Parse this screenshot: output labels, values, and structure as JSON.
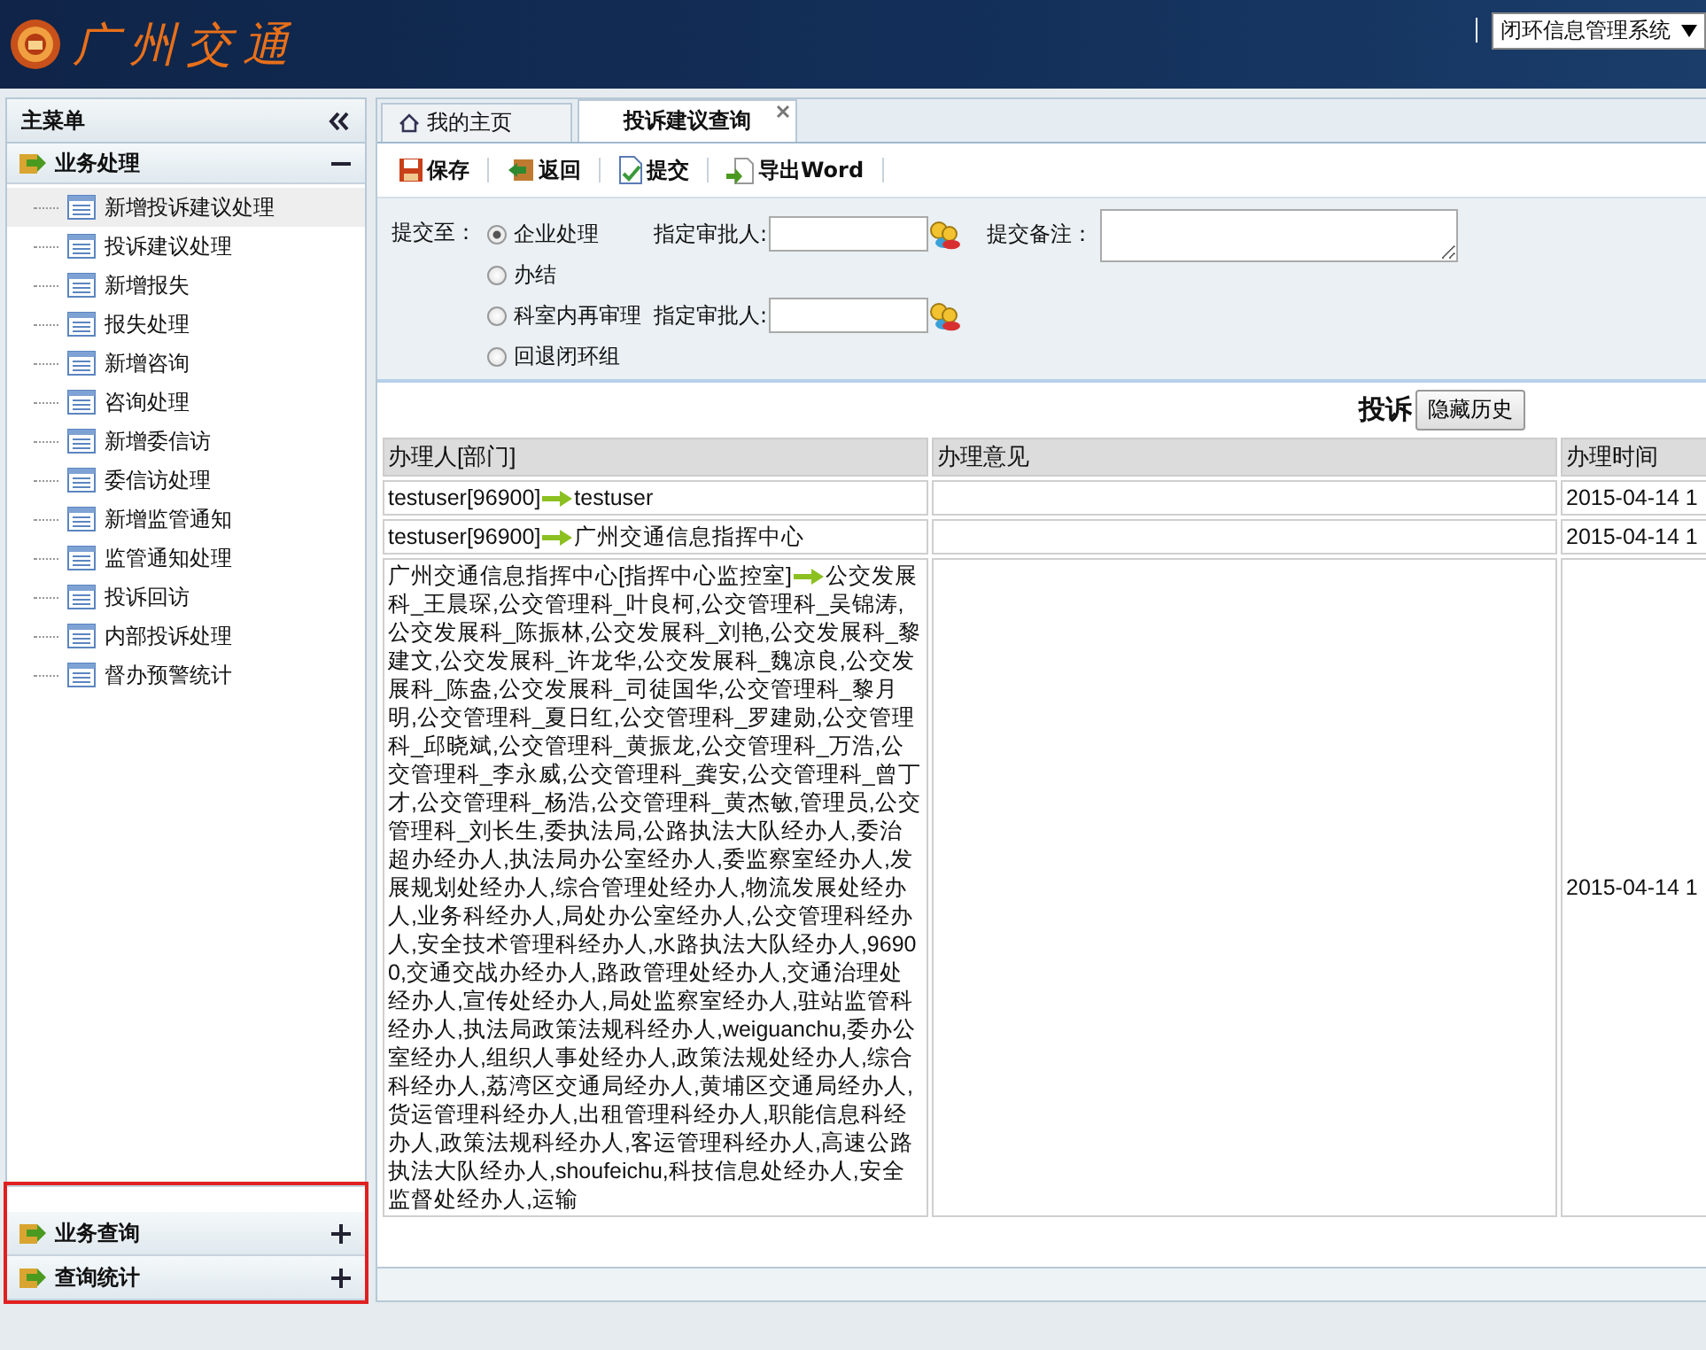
{
  "header": {
    "logo_text": "广州交通",
    "system_select": "闭环信息管理系统"
  },
  "sidebar": {
    "title": "主菜单",
    "lower_sections_highlighted": true,
    "sections": [
      {
        "title": "业务处理",
        "expanded": true,
        "items": [
          {
            "label": "新增投诉建议处理",
            "selected": true
          },
          {
            "label": "投诉建议处理",
            "selected": false
          },
          {
            "label": "新增报失",
            "selected": false
          },
          {
            "label": "报失处理",
            "selected": false
          },
          {
            "label": "新增咨询",
            "selected": false
          },
          {
            "label": "咨询处理",
            "selected": false
          },
          {
            "label": "新增委信访",
            "selected": false
          },
          {
            "label": "委信访处理",
            "selected": false
          },
          {
            "label": "新增监管通知",
            "selected": false
          },
          {
            "label": "监管通知处理",
            "selected": false
          },
          {
            "label": "投诉回访",
            "selected": false
          },
          {
            "label": "内部投诉处理",
            "selected": false
          },
          {
            "label": "督办预警统计",
            "selected": false
          }
        ]
      },
      {
        "title": "业务查询",
        "expanded": false
      },
      {
        "title": "查询统计",
        "expanded": false
      }
    ]
  },
  "tabs": [
    {
      "label": "我的主页",
      "selected": false,
      "kind": "home"
    },
    {
      "label": "投诉建议查询",
      "selected": true,
      "kind": "closable"
    }
  ],
  "toolbar": [
    {
      "label": "保存",
      "kind": "save"
    },
    {
      "label": "返回",
      "kind": "back"
    },
    {
      "label": "提交",
      "kind": "submit"
    },
    {
      "label": "导出Word",
      "kind": "export"
    }
  ],
  "submit_form": {
    "label": "提交至：",
    "note_label": "提交备注：",
    "options": [
      {
        "label": "企业处理",
        "selected": true,
        "approver_label": "指定审批人:"
      },
      {
        "label": "办结",
        "selected": false
      },
      {
        "label": "科室内再审理",
        "selected": false,
        "approver_label": "指定审批人:"
      },
      {
        "label": "回退闭环组",
        "selected": false
      }
    ]
  },
  "history": {
    "title": "投诉",
    "button": "隐藏历史",
    "columns": [
      "办理人[部门]",
      "办理意见",
      "办理时间"
    ],
    "rows": [
      {
        "from": "testuser[96900]",
        "to": "testuser",
        "time": "2015-04-14 1"
      },
      {
        "from": "testuser[96900]",
        "to": "广州交通信息指挥中心",
        "time": "2015-04-14 1"
      },
      {
        "from": "广州交通信息指挥中心[指挥中心监控室]",
        "to": "公交发展科_王晨琛,公交管理科_叶良柯,公交管理科_吴锦涛,公交发展科_陈振林,公交发展科_刘艳,公交发展科_黎建文,公交发展科_许龙华,公交发展科_魏凉良,公交发展科_陈盎,公交发展科_司徒国华,公交管理科_黎月明,公交管理科_夏日红,公交管理科_罗建勋,公交管理科_邱晓斌,公交管理科_黄振龙,公交管理科_万浩,公交管理科_李永威,公交管理科_龚安,公交管理科_曾丁才,公交管理科_杨浩,公交管理科_黄杰敏,管理员,公交管理科_刘长生,委执法局,公路执法大队经办人,委治超办经办人,执法局办公室经办人,委监察室经办人,发展规划处经办人,综合管理处经办人,物流发展处经办人,业务科经办人,局处办公室经办人,公交管理科经办人,安全技术管理科经办人,水路执法大队经办人,96900,交通交战办经办人,路政管理处经办人,交通治理处经办人,宣传处经办人,局处监察室经办人,驻站监管科经办人,执法局政策法规科经办人,weiguanchu,委办公室经办人,组织人事处经办人,政策法规处经办人,综合科经办人,荔湾区交通局经办人,黄埔区交通局经办人,货运管理科经办人,出租管理科经办人,职能信息科经办人,政策法规科经办人,客运管理科经办人,高速公路执法大队经办人,shoufeichu,科技信息处经办人,安全监督处经办人,运输",
        "time": "2015-04-14 1"
      }
    ]
  }
}
